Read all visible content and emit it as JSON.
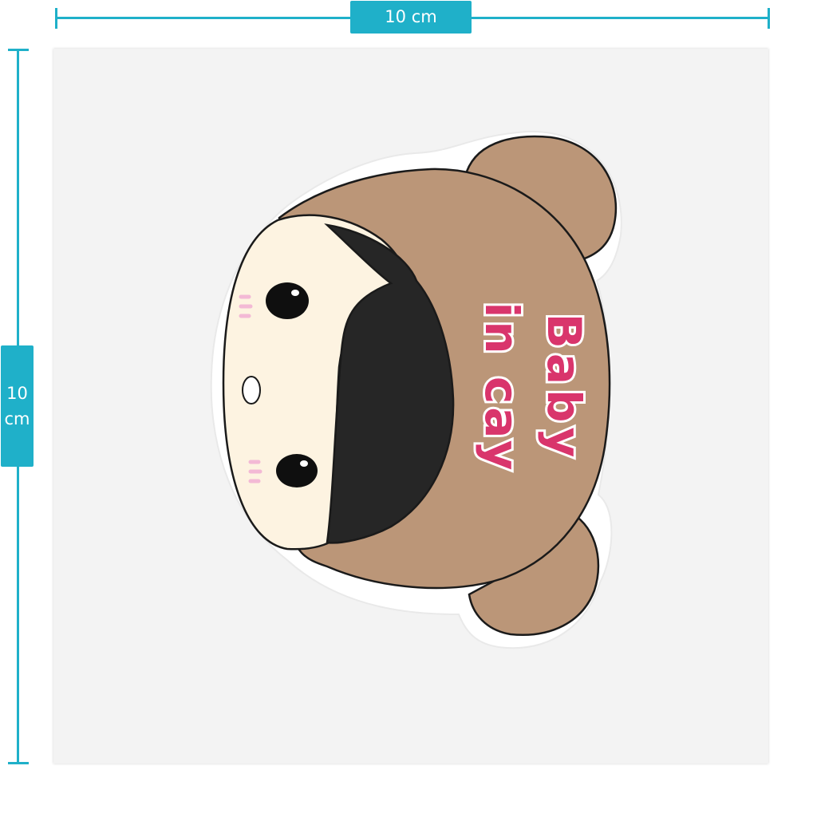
{
  "dimensions": {
    "width_label": "10 cm",
    "height_label_value": "10",
    "height_label_unit": "cm"
  },
  "sticker": {
    "text_line1": "Baby",
    "text_line2": "in cay"
  },
  "colors": {
    "accent": "#1fb0c9",
    "sheet": "#f3f3f3",
    "costume": "#bb9678",
    "face": "#fdf3e1",
    "hair": "#262626",
    "text": "#d9356c",
    "blush": "#f3b9d5"
  },
  "icons": {
    "sticker_art": "bear-hood-baby-icon"
  }
}
